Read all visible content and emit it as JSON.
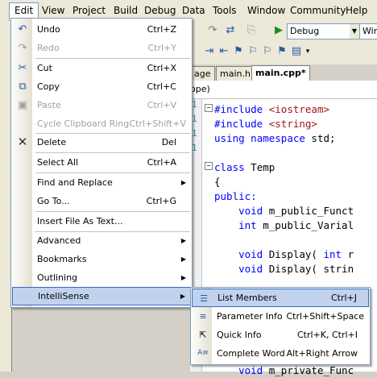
{
  "menubar": {
    "items": [
      "Edit",
      "View",
      "Project",
      "Build",
      "Debug",
      "Data",
      "Tools",
      "Window",
      "Community",
      "Help"
    ]
  },
  "toolbar": {
    "config_combo": "Debug",
    "platform_combo": "Win"
  },
  "tabs": [
    "age",
    "main.h",
    "main.cpp*"
  ],
  "scope": "ope)",
  "editor": {
    "line_numbers": [
      "1",
      "1",
      "1",
      "1"
    ],
    "lines": [
      {
        "text": "#include <iostream>",
        "y": 0
      },
      {
        "text": "#include <string>",
        "y": 1
      },
      {
        "text": "using namespace std;",
        "y": 2
      },
      {
        "text": "class Temp",
        "y": 4
      },
      {
        "text": "{",
        "y": 5
      },
      {
        "text": "public:",
        "y": 6
      },
      {
        "text": "    void m_public_Funct",
        "y": 7
      },
      {
        "text": "    int m_public_Varial",
        "y": 8
      },
      {
        "text": "    void Display( int r",
        "y": 10
      },
      {
        "text": "    void Display( strin",
        "y": 11
      },
      {
        "text": "    void m_private_Func",
        "y": 18
      }
    ]
  },
  "edit_menu": {
    "items": [
      {
        "label": "Undo",
        "shortcut": "Ctrl+Z",
        "icon": "undo-icon",
        "disabled": false
      },
      {
        "label": "Redo",
        "shortcut": "Ctrl+Y",
        "icon": "redo-icon",
        "disabled": true
      },
      {
        "label": "Cut",
        "shortcut": "Ctrl+X",
        "icon": "cut-icon",
        "disabled": false
      },
      {
        "label": "Copy",
        "shortcut": "Ctrl+C",
        "icon": "copy-icon",
        "disabled": false
      },
      {
        "label": "Paste",
        "shortcut": "Ctrl+V",
        "icon": "paste-icon",
        "disabled": true
      },
      {
        "label": "Cycle Clipboard Ring",
        "shortcut": "Ctrl+Shift+V",
        "disabled": true
      },
      {
        "label": "Delete",
        "shortcut": "Del",
        "icon": "delete-icon",
        "disabled": false
      },
      {
        "label": "Select All",
        "shortcut": "Ctrl+A",
        "disabled": false
      },
      {
        "label": "Find and Replace",
        "submenu": true
      },
      {
        "label": "Go To...",
        "shortcut": "Ctrl+G"
      },
      {
        "label": "Insert File As Text..."
      },
      {
        "label": "Advanced",
        "submenu": true
      },
      {
        "label": "Bookmarks",
        "submenu": true
      },
      {
        "label": "Outlining",
        "submenu": true
      },
      {
        "label": "IntelliSense",
        "submenu": true,
        "highlighted": true
      }
    ]
  },
  "intellisense_menu": {
    "items": [
      {
        "label": "List Members",
        "shortcut": "Ctrl+J",
        "highlighted": true
      },
      {
        "label": "Parameter Info",
        "shortcut": "Ctrl+Shift+Space"
      },
      {
        "label": "Quick Info",
        "shortcut": "Ctrl+K, Ctrl+I"
      },
      {
        "label": "Complete Word",
        "shortcut": "Alt+Right Arrow"
      }
    ]
  }
}
